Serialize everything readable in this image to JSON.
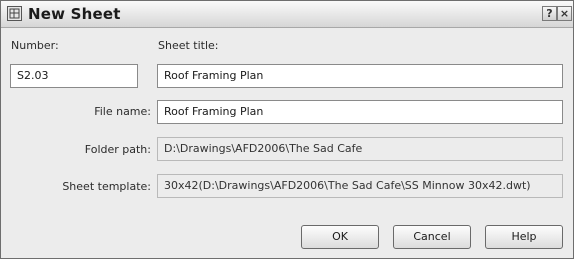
{
  "window": {
    "title": "New Sheet",
    "help_glyph": "?",
    "close_glyph": "×"
  },
  "form": {
    "number_label": "Number:",
    "number_value": "S2.03",
    "sheet_title_label": "Sheet title:",
    "sheet_title_value": "Roof Framing Plan",
    "file_name_label": "File name:",
    "file_name_value": "Roof Framing Plan",
    "folder_path_label": "Folder path:",
    "folder_path_value": "D:\\Drawings\\AFD2006\\The Sad Cafe",
    "sheet_template_label": "Sheet template:",
    "sheet_template_value": "30x42(D:\\Drawings\\AFD2006\\The Sad Cafe\\SS Minnow 30x42.dwt)"
  },
  "buttons": {
    "ok": "OK",
    "cancel": "Cancel",
    "help": "Help"
  }
}
